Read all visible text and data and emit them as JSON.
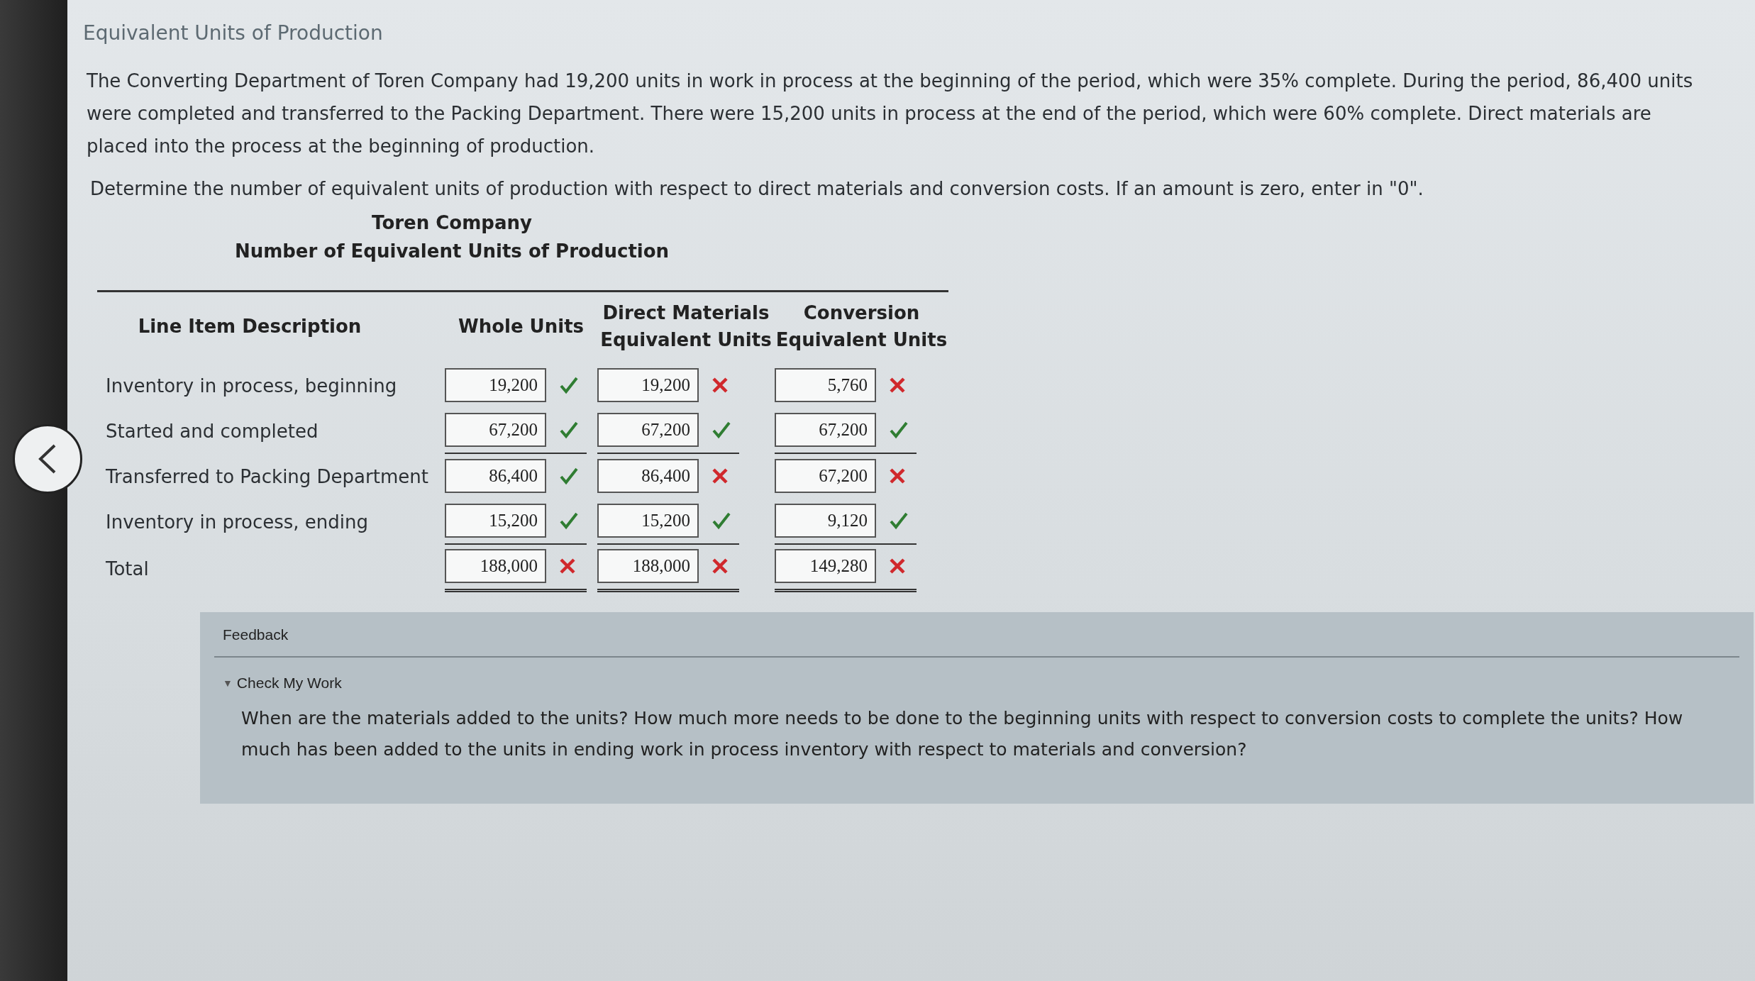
{
  "title": "Equivalent Units of Production",
  "paragraph": "The Converting Department of Toren Company had 19,200 units in work in process at the beginning of the period, which were 35% complete. During the period, 86,400 units were completed and transferred to the Packing Department. There were 15,200 units in process at the end of the period, which were 60% complete. Direct materials are placed into the process at the beginning of production.",
  "instruction": "Determine the number of equivalent units of production with respect to direct materials and conversion costs. If an amount is zero, enter in \"0\".",
  "company": "Toren Company",
  "report_title": "Number of Equivalent Units of Production",
  "table": {
    "columns": [
      {
        "lines": [
          "Line Item Description"
        ]
      },
      {
        "lines": [
          "Whole Units"
        ]
      },
      {
        "lines": [
          "Direct Materials",
          "Equivalent Units"
        ]
      },
      {
        "lines": [
          "Conversion",
          "Equivalent Units"
        ]
      }
    ],
    "rows": [
      {
        "kind": "plain",
        "cells": [
          {
            "value": "Inventory in process, beginning"
          },
          {
            "value": "19,200",
            "correct": true
          },
          {
            "value": "19,200",
            "correct": false
          },
          {
            "value": "5,760",
            "correct": false
          }
        ]
      },
      {
        "kind": "subtotal",
        "cells": [
          {
            "value": "Started and completed"
          },
          {
            "value": "67,200",
            "correct": true
          },
          {
            "value": "67,200",
            "correct": true
          },
          {
            "value": "67,200",
            "correct": true
          }
        ]
      },
      {
        "kind": "plain",
        "cells": [
          {
            "value": "Transferred to Packing Department"
          },
          {
            "value": "86,400",
            "correct": true
          },
          {
            "value": "86,400",
            "correct": false
          },
          {
            "value": "67,200",
            "correct": false
          }
        ]
      },
      {
        "kind": "subtotal",
        "cells": [
          {
            "value": "Inventory in process, ending"
          },
          {
            "value": "15,200",
            "correct": true
          },
          {
            "value": "15,200",
            "correct": true
          },
          {
            "value": "9,120",
            "correct": true
          }
        ]
      },
      {
        "kind": "total",
        "cells": [
          {
            "value": "Total"
          },
          {
            "value": "188,000",
            "correct": false
          },
          {
            "value": "188,000",
            "correct": false
          },
          {
            "value": "149,280",
            "correct": false
          }
        ]
      }
    ]
  },
  "feedback": {
    "heading": "Feedback",
    "toggle": "▼",
    "section": "Check My Work",
    "expanded": true,
    "text": "When are the materials added to the units? How much more needs to be done to the beginning units with respect to conversion costs to complete the units? How much has been added to the units in ending work in process inventory with respect to materials and conversion?"
  }
}
